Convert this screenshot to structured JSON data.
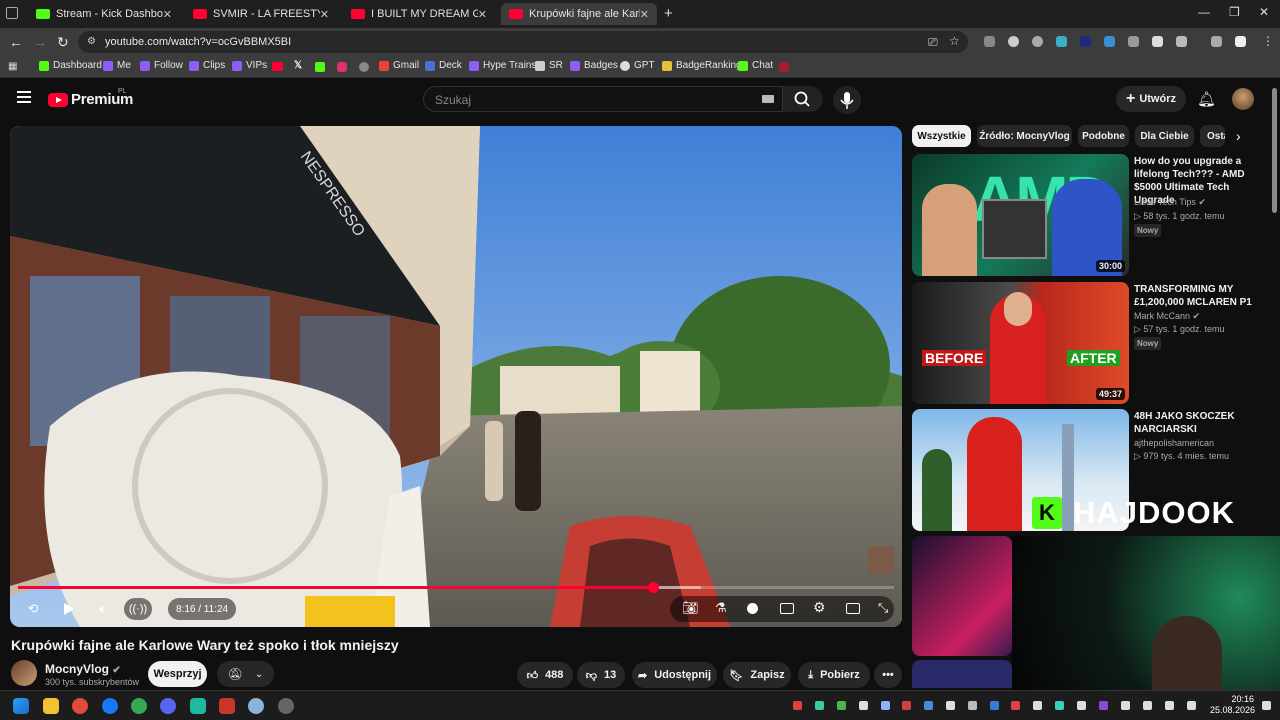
{
  "browser": {
    "tabs": [
      {
        "title": "Stream - Kick Dashboard",
        "favicon_color": "#53fc18"
      },
      {
        "title": "SVMIR - LA FREESTYLE - YouTu",
        "favicon_color": "#ff0033"
      },
      {
        "title": "I BUILT MY DREAM GAMING R",
        "favicon_color": "#ff0033"
      },
      {
        "title": "Krupówki fajne ale Karlowe War",
        "favicon_color": "#ff0033"
      }
    ],
    "url": "youtube.com/watch?v=ocGvBBMX5BI",
    "bookmarks": [
      "Dashboard",
      "Me",
      "Follow",
      "Clips",
      "VIPs",
      "Gmail",
      "Deck",
      "Hype Trains",
      "SR",
      "Badges",
      "GPT",
      "BadgeRanking",
      "Chat"
    ]
  },
  "yt": {
    "logo": "Premium",
    "logo_region": "PL",
    "search_placeholder": "Szukaj",
    "create_label": "Utwórz"
  },
  "video": {
    "time": "8:16 / 11:24",
    "progress_fraction": 0.725,
    "buffered_fraction": 0.78,
    "title": "Krupówki fajne ale Karlowe Wary też spoko i tłok mniejszy",
    "channel": "MocnyVlog",
    "subscribers": "300 tys. subskrybentów",
    "support_label": "Wesprzyj",
    "likes": "488",
    "dislikes": "13",
    "share_label": "Udostępnij",
    "save_label": "Zapisz",
    "download_label": "Pobierz"
  },
  "chips": [
    "Wszystkie",
    "Źródło: MocnyVlog",
    "Podobne",
    "Dla Ciebie",
    "Ostatnio"
  ],
  "recommendations": [
    {
      "title": "How do you upgrade a lifelong Tech??? - AMD $5000 Ultimate Tech Upgrade",
      "channel": "Linus Tech Tips",
      "meta": "58 tys.  1 godz. temu",
      "badge": "Nowy",
      "duration": "30:00",
      "thumb_text": "AMD"
    },
    {
      "title": "TRANSFORMING MY £1,200,000 MCLAREN P1",
      "channel": "Mark McCann",
      "meta": "57 tys.  1 godz. temu",
      "badge": "Nowy",
      "duration": "49:37",
      "thumb_before": "BEFORE",
      "thumb_after": "AFTER"
    },
    {
      "title": "48H JAKO SKOCZEK NARCIARSKI",
      "channel": "ajthepolishamerican",
      "meta": "979 tys.  4 mies. temu",
      "badge": "",
      "duration": ""
    }
  ],
  "overlay": {
    "watermark": "HAJDOOK"
  },
  "taskbar": {
    "time": "20:16",
    "date": "25.08.2026"
  }
}
